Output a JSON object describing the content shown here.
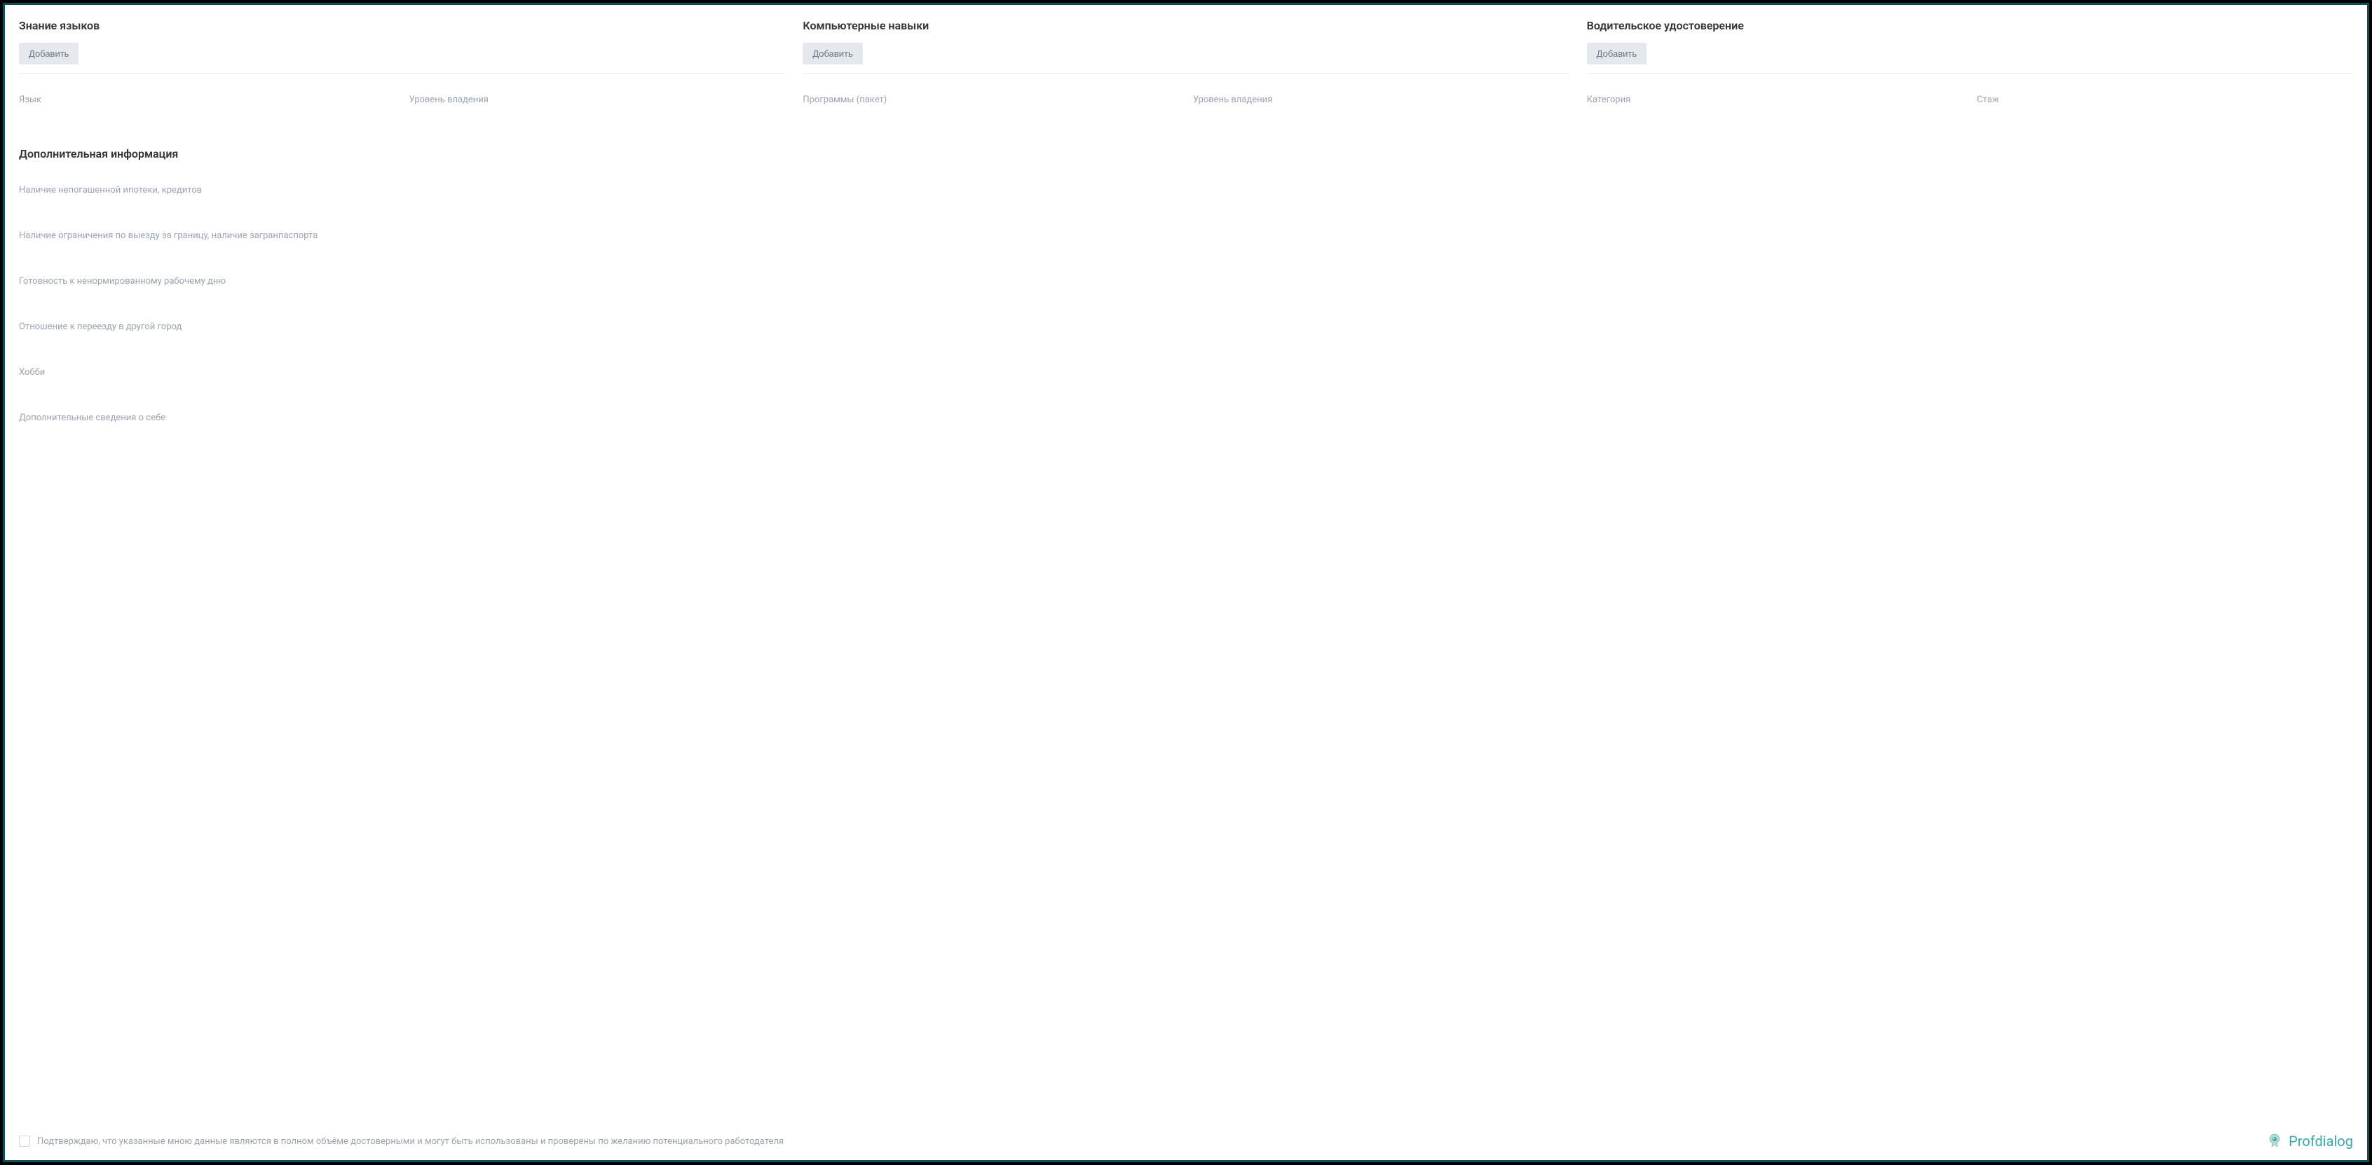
{
  "skills": {
    "languages": {
      "title": "Знание языков",
      "add_btn": "Добавить",
      "col1": "Язык",
      "col2": "Уровень владения"
    },
    "computer": {
      "title": "Компьютерные навыки",
      "add_btn": "Добавить",
      "col1": "Программы (пакет)",
      "col2": "Уровень владения"
    },
    "driver": {
      "title": "Водительское удостоверение",
      "add_btn": "Добавить",
      "col1": "Категория",
      "col2": "Стаж"
    }
  },
  "additional": {
    "title": "Дополнительная информация",
    "fields": {
      "mortgage": "Наличие непогашенной ипотеки, кредитов",
      "travel": "Наличие ограничения по выезду за границу, наличие загранпаспорта",
      "overtime": "Готовность к ненормированному рабочему дню",
      "relocation": "Отношение к переезду в другой город",
      "hobby": "Хобби",
      "extra": "Дополнительные сведения о себе"
    }
  },
  "consent": {
    "text": "Подтверждаю, что указанные мною данные являются в полном объёме достоверными и могут быть использованы и проверены по желанию потенциального работодателя"
  },
  "logo": {
    "text": "Profdialog"
  }
}
